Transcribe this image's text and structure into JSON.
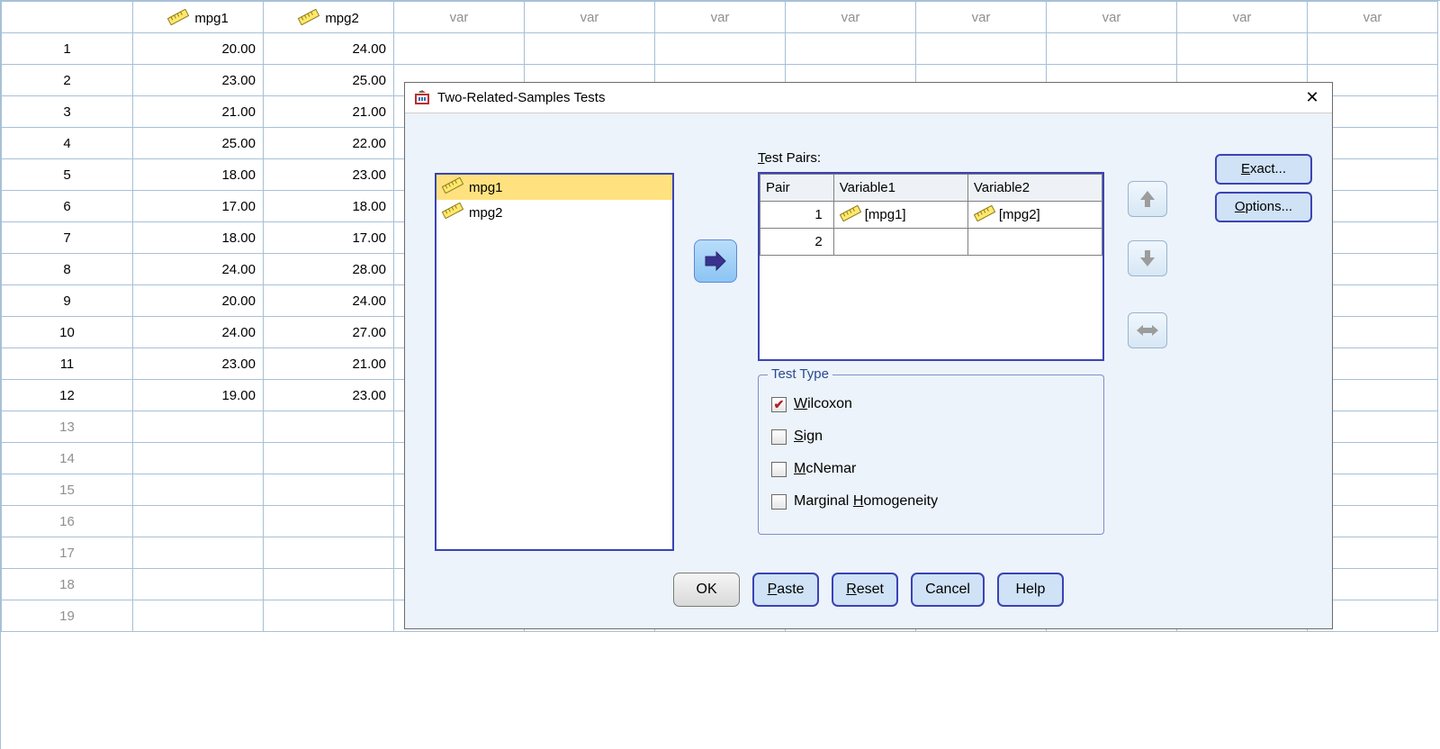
{
  "sheet": {
    "columns": [
      {
        "name": "mpg1",
        "is_var": true
      },
      {
        "name": "mpg2",
        "is_var": true
      },
      {
        "name": "var",
        "is_var": false
      },
      {
        "name": "var",
        "is_var": false
      },
      {
        "name": "var",
        "is_var": false
      },
      {
        "name": "var",
        "is_var": false
      },
      {
        "name": "var",
        "is_var": false
      },
      {
        "name": "var",
        "is_var": false
      },
      {
        "name": "var",
        "is_var": false
      },
      {
        "name": "var",
        "is_var": false
      }
    ],
    "data_rows": [
      [
        "20.00",
        "24.00"
      ],
      [
        "23.00",
        "25.00"
      ],
      [
        "21.00",
        "21.00"
      ],
      [
        "25.00",
        "22.00"
      ],
      [
        "18.00",
        "23.00"
      ],
      [
        "17.00",
        "18.00"
      ],
      [
        "18.00",
        "17.00"
      ],
      [
        "24.00",
        "28.00"
      ],
      [
        "20.00",
        "24.00"
      ],
      [
        "24.00",
        "27.00"
      ],
      [
        "23.00",
        "21.00"
      ],
      [
        "19.00",
        "23.00"
      ]
    ],
    "empty_row_count": 7
  },
  "dialog": {
    "title": "Two-Related-Samples Tests",
    "var_list": [
      {
        "label": "mpg1",
        "selected": true
      },
      {
        "label": "mpg2",
        "selected": false
      }
    ],
    "pairs_label_prefix": "T",
    "pairs_label_rest": "est Pairs:",
    "pairs_headers": {
      "pair": "Pair",
      "v1": "Variable1",
      "v2": "Variable2"
    },
    "pairs": [
      {
        "n": "1",
        "v1": "[mpg1]",
        "v2": "[mpg2]"
      },
      {
        "n": "2",
        "v1": "",
        "v2": ""
      }
    ],
    "side": {
      "exact_ul": "E",
      "exact_rest": "xact...",
      "options_ul": "O",
      "options_rest": "ptions..."
    },
    "group": {
      "legend": "Test Type",
      "opts": [
        {
          "checked": true,
          "ul": "W",
          "rest": "ilcoxon"
        },
        {
          "checked": false,
          "ul": "S",
          "rest": "ign"
        },
        {
          "checked": false,
          "ul": "M",
          "rest": "cNemar"
        },
        {
          "checked": false,
          "pre": "Marginal ",
          "ul": "H",
          "rest": "omogeneity"
        }
      ]
    },
    "buttons": {
      "ok": "OK",
      "paste_ul": "P",
      "paste_rest": "aste",
      "reset_ul": "R",
      "reset_rest": "eset",
      "cancel": "Cancel",
      "help": "Help"
    }
  }
}
